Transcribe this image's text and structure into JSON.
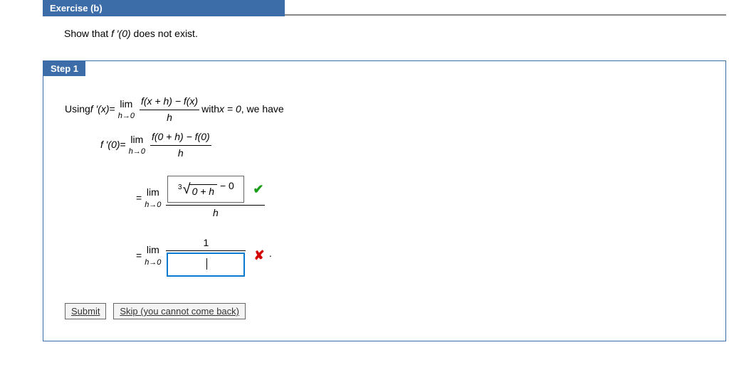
{
  "exercise": {
    "label": "Exercise (b)"
  },
  "prompt": {
    "before": "Show that ",
    "math": "f ′(0)",
    "after": " does not exist."
  },
  "step": {
    "label": "Step 1"
  },
  "line1": {
    "using": "Using  ",
    "fprime": "f ′(x)",
    "eq": "  =  ",
    "lim_top": "lim",
    "lim_bot": "h→0",
    "num": "f(x + h) − f(x)",
    "den": "h",
    "with": "  with  ",
    "xeq": "x = 0",
    "wehave": ", we have"
  },
  "line2": {
    "fprime0": "f ′(0)",
    "eq": "  =  ",
    "lim_top": "lim",
    "lim_bot": "h→0",
    "num": "f(0 + h) − f(0)",
    "den": "h"
  },
  "line3": {
    "eq": "=  ",
    "lim_top": "lim",
    "lim_bot": "h→0",
    "root_index": "3",
    "radicand": "0 + h",
    "minus": " − 0",
    "den": "h"
  },
  "line4": {
    "eq": "=  ",
    "lim_top": "lim",
    "lim_bot": "h→0",
    "num": "1",
    "input_value": ""
  },
  "marks": {
    "correct": "✔",
    "wrong": "✘",
    "dot": "·"
  },
  "buttons": {
    "submit": "Submit",
    "skip": "Skip (you cannot come back)"
  }
}
